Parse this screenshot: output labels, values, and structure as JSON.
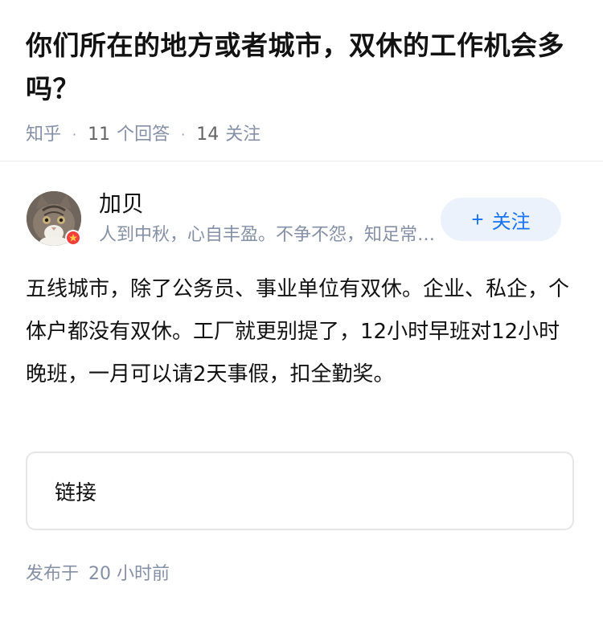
{
  "question": {
    "title": "你们所在的地方或者城市，双休的工作机会多吗？",
    "source": "知乎",
    "answer_count": "11",
    "answer_label": "个回答",
    "follower_count": "14",
    "follower_label": "关注"
  },
  "author": {
    "name": "加贝",
    "bio": "人到中秋，心自丰盈。不争不怨，知足常乐。",
    "follow_label": "关注"
  },
  "answer": {
    "content": "五线城市，除了公务员、事业单位有双休。企业、私企，个体户都没有双休。工厂就更别提了，12小时早班对12小时晚班，一月可以请2天事假，扣全勤奖。",
    "link_label": "链接",
    "published_label": "发布于",
    "published_time": "20 小时前"
  },
  "colors": {
    "primary_text": "#121212",
    "secondary_text": "#8590a6",
    "accent_blue": "#1772f6",
    "follow_bg": "#ebf2fc",
    "badge_red": "#f1403c"
  }
}
